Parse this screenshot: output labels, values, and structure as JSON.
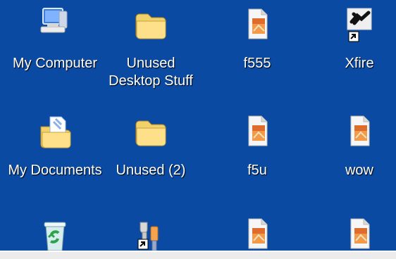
{
  "desktop": {
    "items": [
      {
        "label": "My Computer",
        "icon": "computer-icon"
      },
      {
        "label": "Unused\nDesktop Stuff",
        "icon": "folder-icon"
      },
      {
        "label": "f555",
        "icon": "document-icon"
      },
      {
        "label": "Xfire",
        "icon": "xfire-icon"
      },
      {
        "label": "My Documents",
        "icon": "documents-folder-icon"
      },
      {
        "label": "Unused (2)",
        "icon": "folder-icon"
      },
      {
        "label": "f5u",
        "icon": "document-icon"
      },
      {
        "label": "wow",
        "icon": "document-icon"
      },
      {
        "label": "",
        "icon": "recycle-bin-icon"
      },
      {
        "label": "",
        "icon": "tools-icon"
      },
      {
        "label": "",
        "icon": "document-icon"
      },
      {
        "label": "",
        "icon": "document-icon"
      }
    ]
  },
  "colors": {
    "desktop_background": "#0a4aa3",
    "label_text": "#ffffff"
  }
}
